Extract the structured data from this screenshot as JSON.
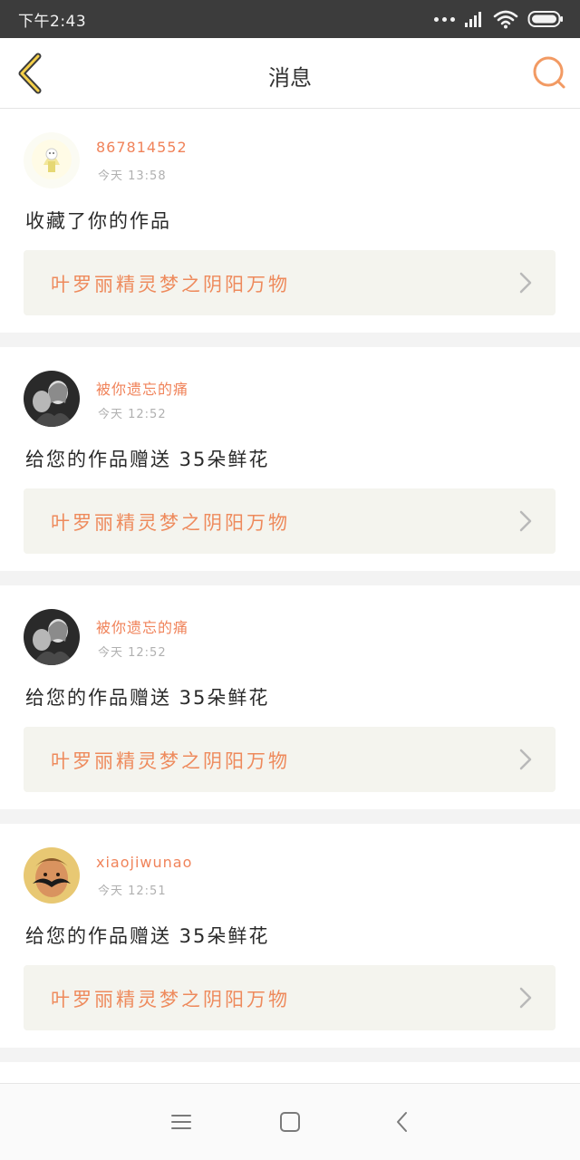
{
  "status_bar": {
    "time": "下午2:43",
    "icons": [
      "more-dots-icon",
      "signal-icon",
      "wifi-icon",
      "battery-icon"
    ]
  },
  "header": {
    "title": "消息",
    "back_icon": "back-chevron-icon",
    "search_icon": "search-icon"
  },
  "colors": {
    "accent": "#f0835a",
    "work_link_bg": "#f4f4ee",
    "status_bar_bg": "#3c3c3c"
  },
  "messages": [
    {
      "username": "867814552",
      "time": "今天 13:58",
      "text": "收藏了你的作品",
      "work_title": "叶罗丽精灵梦之阴阳万物"
    },
    {
      "username": "被你遗忘的痛",
      "time": "今天 12:52",
      "text": "给您的作品赠送 35朵鲜花",
      "work_title": "叶罗丽精灵梦之阴阳万物"
    },
    {
      "username": "被你遗忘的痛",
      "time": "今天 12:52",
      "text": "给您的作品赠送 35朵鲜花",
      "work_title": "叶罗丽精灵梦之阴阳万物"
    },
    {
      "username": "xiaojiwunao",
      "time": "今天 12:51",
      "text": "给您的作品赠送 35朵鲜花",
      "work_title": "叶罗丽精灵梦之阴阳万物"
    }
  ],
  "nav_bar": {
    "icons": [
      "menu-icon",
      "home-square-icon",
      "back-triangle-icon"
    ]
  }
}
